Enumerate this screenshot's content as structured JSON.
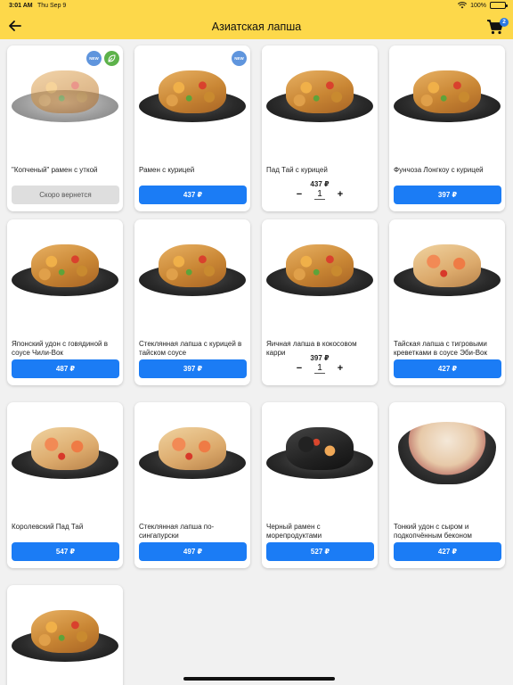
{
  "status_bar": {
    "time": "3:01 AM",
    "date": "Thu Sep 9",
    "battery": "100%"
  },
  "header": {
    "title": "Азиатская лапша",
    "cart_count": "2"
  },
  "labels": {
    "new_badge": "NEW",
    "out_of_stock": "Скоро вернется"
  },
  "products": [
    {
      "name": "\"Копченый\" рамен с уткой",
      "state": "unavailable"
    },
    {
      "name": "Рамен с курицей",
      "price": "437 ₽"
    },
    {
      "name": "Пад Тай с курицей",
      "price": "437 ₽",
      "quantity": "1"
    },
    {
      "name": "Фунчоза Лонгкоу с курицей",
      "price": "397 ₽"
    },
    {
      "name": "Японский удон с говядиной в соусе Чили-Вок",
      "price": "487 ₽"
    },
    {
      "name": "Стеклянная лапша с курицей в тайском соусе",
      "price": "397 ₽"
    },
    {
      "name": "Яичная лапша в кокосовом карри",
      "price": "397 ₽",
      "quantity": "1"
    },
    {
      "name": "Тайская лапша с тигровыми креветками в соусе Эби-Вок",
      "price": "427 ₽"
    },
    {
      "name": "Королевский Пад Тай",
      "price": "547 ₽"
    },
    {
      "name": "Стеклянная лапша по-сингапурски",
      "price": "497 ₽"
    },
    {
      "name": "Черный рамен с морепродуктами",
      "price": "527 ₽"
    },
    {
      "name": "Тонкий удон с сыром и подкопчённым беконом",
      "price": "427 ₽"
    },
    {
      "name": ""
    }
  ],
  "stepper": {
    "minus": "−",
    "plus": "+"
  },
  "colors": {
    "header": "#fdd84a",
    "accent": "#1b7cf5",
    "badge": "#2a78e4"
  }
}
